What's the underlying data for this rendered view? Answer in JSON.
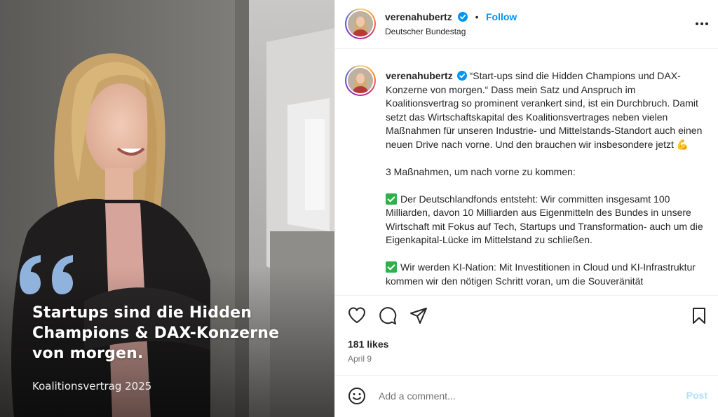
{
  "post": {
    "username": "verenahubertz",
    "follow_label": "Follow",
    "location": "Deutscher Bundestag",
    "more_icon": "more-horizontal-icon"
  },
  "image": {
    "headline_lines": [
      "Startups sind die Hidden",
      "Champions & DAX-Konzerne",
      "von morgen."
    ],
    "caption": "Koalitionsvertrag 2025",
    "quote_color": "#8fb3dc"
  },
  "caption": {
    "paragraph1": "“Start-ups sind die Hidden Champions und DAX-Konzerne von morgen.“ Dass mein Satz und Anspruch im Koalitionsvertrag so prominent verankert sind, ist ein Durchbruch. Damit setzt das Wirtschaftskapital des Koalitionsvertrages neben vielen Maßnahmen für unseren Industrie- und Mittelstands-Standort auch einen neuen Drive nach vorne. Und den brauchen wir insbesondere jetzt",
    "emoji1": "💪",
    "paragraph2": "3 Maßnahmen, um nach vorne zu kommen:",
    "paragraph3": "Der Deutschlandfonds entsteht: Wir committen insgesamt 100 Milliarden, davon 10 Milliarden aus Eigenmitteln des Bundes in unsere Wirtschaft mit Fokus auf Tech, Startups und Transformation- auch um die Eigenkapital-Lücke im Mittelstand zu schließen.",
    "paragraph4": "Wir werden KI-Nation: Mit Investitionen in Cloud und KI-Infrastruktur kommen wir den nötigen Schritt voran, um die Souveränität"
  },
  "stats": {
    "likes": "181 likes",
    "date": "April 9"
  },
  "comment_box": {
    "placeholder": "Add a comment...",
    "post_label": "Post"
  },
  "colors": {
    "accent": "#0095f6",
    "verified": "#0095f6",
    "check": "#2fb14a"
  }
}
